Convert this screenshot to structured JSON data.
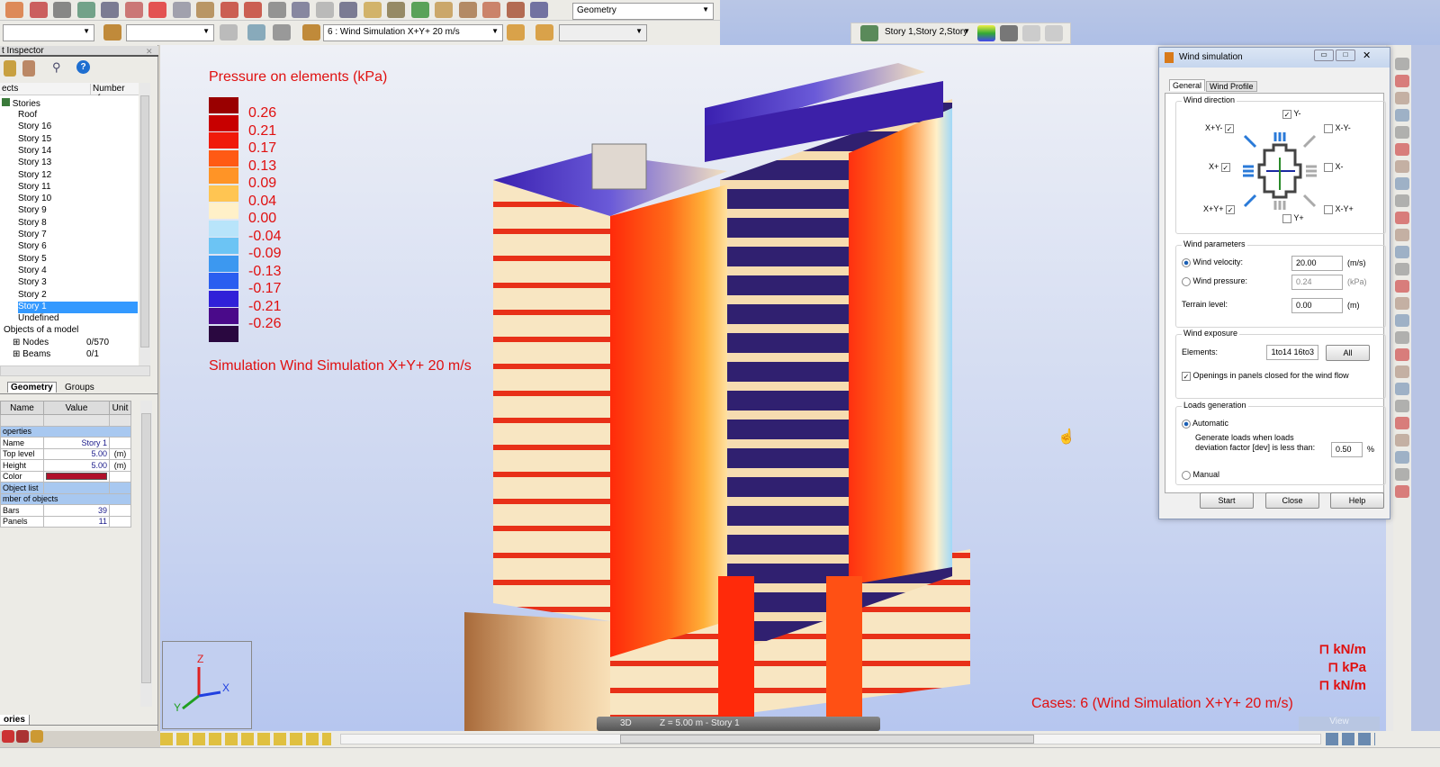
{
  "toolbar": {
    "view_combo": "Geometry",
    "case_combo": "6 : Wind Simulation X+Y+ 20 m/s",
    "story_combo": "Story 1,Story 2,Story",
    "icons": [
      "open-icon",
      "save-icon",
      "print-icon",
      "book-icon",
      "preview-icon",
      "camera-icon",
      "delete-icon",
      "copy-icon",
      "paste-icon",
      "undo-icon",
      "redo-icon",
      "calculator-icon",
      "results-table-icon",
      "lock-icon",
      "zoom-icon",
      "zoom-window-icon",
      "view-icon",
      "supports-icon",
      "dimension-icon",
      "section-icon",
      "loads-icon",
      "wrench-icon",
      "layout-icon"
    ]
  },
  "inspector": {
    "title": "t Inspector",
    "col_objects": "ects",
    "col_number": "Number of...",
    "root": "Stories",
    "stories": [
      "Roof",
      "Story 16",
      "Story 15",
      "Story 14",
      "Story 13",
      "Story 12",
      "Story 11",
      "Story 10",
      "Story 9",
      "Story 8",
      "Story 7",
      "Story 6",
      "Story 5",
      "Story 4",
      "Story 3",
      "Story 2",
      "Story 1",
      "Undefined"
    ],
    "selected": "Story 1",
    "objects_label": "Objects of a model",
    "objects": [
      {
        "name": "Nodes",
        "count": "0/570"
      },
      {
        "name": "Beams",
        "count": "0/1"
      }
    ],
    "tabs": [
      "Geometry",
      "Groups"
    ],
    "table": {
      "headers": [
        "Name",
        "Value",
        "Unit"
      ],
      "sections": [
        {
          "title": "operties",
          "rows": [
            [
              "Name",
              "Story 1",
              ""
            ],
            [
              "Top level",
              "5.00",
              "(m)"
            ],
            [
              "Height",
              "5.00",
              "(m)"
            ],
            [
              "Color",
              "",
              ""
            ],
            [
              "Object list",
              "",
              ""
            ]
          ]
        },
        {
          "title": "mber of objects",
          "rows": [
            [
              "Bars",
              "39",
              ""
            ],
            [
              "Panels",
              "11",
              ""
            ]
          ]
        }
      ]
    },
    "color_value": "#b0102a",
    "bottom_tab": "ories"
  },
  "legend": {
    "title": "Pressure on elements (kPa)",
    "items": [
      {
        "v": "0.26",
        "c": "#9a0000"
      },
      {
        "v": "0.21",
        "c": "#c80000"
      },
      {
        "v": "0.17",
        "c": "#f01a0a"
      },
      {
        "v": "0.13",
        "c": "#ff5a14"
      },
      {
        "v": "0.09",
        "c": "#ff9426"
      },
      {
        "v": "0.04",
        "c": "#ffc552"
      },
      {
        "v": "0.00",
        "c": "#fff0c8"
      },
      {
        "v": "-0.04",
        "c": "#b8e4fa"
      },
      {
        "v": "-0.09",
        "c": "#6cc4f4"
      },
      {
        "v": "-0.13",
        "c": "#3c98f0"
      },
      {
        "v": "-0.17",
        "c": "#2a5ef0"
      },
      {
        "v": "-0.21",
        "c": "#3020d8"
      },
      {
        "v": "-0.26",
        "c": "#4a0a8a"
      },
      {
        "v": "",
        "c": "#2a0840"
      }
    ],
    "simulation": "Simulation Wind Simulation X+Y+ 20 m/s"
  },
  "units": [
    "kN/m",
    "kPa",
    "kN/m"
  ],
  "cases": "Cases: 6 (Wind Simulation X+Y+ 20 m/s)",
  "viewbar": {
    "mode": "3D",
    "level": "Z = 5.00 m - Story 1",
    "view_btn": "View"
  },
  "axes": {
    "x": "X",
    "y": "Y",
    "z": "Z"
  },
  "dialog": {
    "title": "Wind simulation",
    "tabs": [
      "General",
      "Wind Profile"
    ],
    "direction": {
      "title": "Wind direction",
      "items": [
        {
          "label": "Y-",
          "checked": true
        },
        {
          "label": "X+Y-",
          "checked": true
        },
        {
          "label": "X-Y-",
          "checked": false
        },
        {
          "label": "X+",
          "checked": true
        },
        {
          "label": "X-",
          "checked": false
        },
        {
          "label": "X+Y+",
          "checked": true
        },
        {
          "label": "X-Y+",
          "checked": false
        },
        {
          "label": "Y+",
          "checked": false
        }
      ]
    },
    "params": {
      "title": "Wind parameters",
      "velocity_label": "Wind velocity:",
      "velocity": "20.00",
      "velocity_unit": "(m/s)",
      "pressure_label": "Wind pressure:",
      "pressure": "0.24",
      "pressure_unit": "(kPa)",
      "terrain_label": "Terrain level:",
      "terrain": "0.00",
      "terrain_unit": "(m)"
    },
    "exposure": {
      "title": "Wind exposure",
      "elements_label": "Elements:",
      "elements": "1to14 16to3",
      "all": "All",
      "openings": "Openings in panels closed for the wind flow"
    },
    "loads": {
      "title": "Loads generation",
      "automatic": "Automatic",
      "desc1": "Generate loads when loads",
      "desc2": "deviation factor [dev] is less than:",
      "dev": "0.50",
      "dev_unit": "%",
      "manual": "Manual"
    },
    "buttons": {
      "start": "Start",
      "close": "Close",
      "help": "Help"
    }
  }
}
